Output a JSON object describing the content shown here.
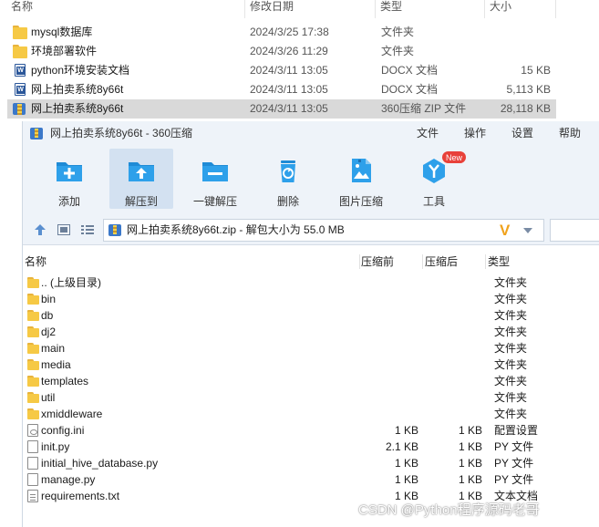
{
  "explorer": {
    "columns": {
      "name": "名称",
      "modified": "修改日期",
      "type": "类型",
      "size": "大小"
    },
    "rows": [
      {
        "name": "mysql数据库",
        "modified": "2024/3/25 17:38",
        "type": "文件夹",
        "size": "",
        "icon": "folder-icon"
      },
      {
        "name": "环境部署软件",
        "modified": "2024/3/26 11:29",
        "type": "文件夹",
        "size": "",
        "icon": "folder-icon"
      },
      {
        "name": "python环境安装文档",
        "modified": "2024/3/11 13:05",
        "type": "DOCX 文档",
        "size": "15 KB",
        "icon": "docx-icon"
      },
      {
        "name": "网上拍卖系统8y66t",
        "modified": "2024/3/11 13:05",
        "type": "DOCX 文档",
        "size": "5,113 KB",
        "icon": "docx-icon"
      },
      {
        "name": "网上拍卖系统8y66t",
        "modified": "2024/3/11 13:05",
        "type": "360压缩 ZIP 文件",
        "size": "28,118 KB",
        "icon": "zip-icon",
        "selected": true
      }
    ]
  },
  "zipwindow": {
    "title": "网上拍卖系统8y66t - 360压缩",
    "menu": [
      "文件",
      "操作",
      "设置",
      "帮助"
    ],
    "toolbar": [
      {
        "label": "添加",
        "icon": "add-icon"
      },
      {
        "label": "解压到",
        "icon": "extract-to-icon",
        "active": true
      },
      {
        "label": "一键解压",
        "icon": "one-click-extract-icon"
      },
      {
        "label": "删除",
        "icon": "delete-icon"
      },
      {
        "label": "图片压缩",
        "icon": "image-compress-icon"
      },
      {
        "label": "工具",
        "icon": "tools-icon",
        "badge": "New"
      }
    ],
    "address": "网上拍卖系统8y66t.zip - 解包大小为 55.0 MB",
    "columns": {
      "name": "名称",
      "compressed_before": "压缩前",
      "compressed_after": "压缩后",
      "type": "类型"
    },
    "files": [
      {
        "name": ".. (上级目录)",
        "before": "",
        "after": "",
        "type": "文件夹",
        "icon": "folder-icon"
      },
      {
        "name": "bin",
        "before": "",
        "after": "",
        "type": "文件夹",
        "icon": "folder-icon"
      },
      {
        "name": "db",
        "before": "",
        "after": "",
        "type": "文件夹",
        "icon": "folder-icon"
      },
      {
        "name": "dj2",
        "before": "",
        "after": "",
        "type": "文件夹",
        "icon": "folder-icon"
      },
      {
        "name": "main",
        "before": "",
        "after": "",
        "type": "文件夹",
        "icon": "folder-icon"
      },
      {
        "name": "media",
        "before": "",
        "after": "",
        "type": "文件夹",
        "icon": "folder-icon"
      },
      {
        "name": "templates",
        "before": "",
        "after": "",
        "type": "文件夹",
        "icon": "folder-icon"
      },
      {
        "name": "util",
        "before": "",
        "after": "",
        "type": "文件夹",
        "icon": "folder-icon"
      },
      {
        "name": "xmiddleware",
        "before": "",
        "after": "",
        "type": "文件夹",
        "icon": "folder-icon"
      },
      {
        "name": "config.ini",
        "before": "1 KB",
        "after": "1 KB",
        "type": "配置设置",
        "icon": "config-file-icon"
      },
      {
        "name": "init.py",
        "before": "2.1 KB",
        "after": "1 KB",
        "type": "PY 文件",
        "icon": "python-file-icon"
      },
      {
        "name": "initial_hive_database.py",
        "before": "1 KB",
        "after": "1 KB",
        "type": "PY 文件",
        "icon": "python-file-icon"
      },
      {
        "name": "manage.py",
        "before": "1 KB",
        "after": "1 KB",
        "type": "PY 文件",
        "icon": "python-file-icon"
      },
      {
        "name": "requirements.txt",
        "before": "1 KB",
        "after": "1 KB",
        "type": "文本文档",
        "icon": "text-file-icon"
      }
    ]
  },
  "watermark": "CSDN @Python程序源码老哥"
}
